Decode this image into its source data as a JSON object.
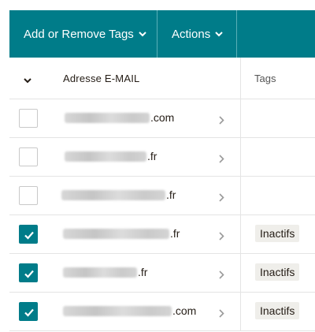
{
  "toolbar": {
    "add_remove_tags_label": "Add or Remove Tags",
    "actions_label": "Actions",
    "background_color": "#007c89"
  },
  "table": {
    "columns": {
      "email": "Adresse E-MAIL",
      "tags": "Tags"
    },
    "rows": [
      {
        "email_suffix": ".com",
        "checked": false,
        "tag": ""
      },
      {
        "email_suffix": ".fr",
        "checked": false,
        "tag": ""
      },
      {
        "email_suffix": ".fr",
        "checked": false,
        "tag": ""
      },
      {
        "email_suffix": ".fr",
        "checked": true,
        "tag": "Inactifs"
      },
      {
        "email_suffix": ".fr",
        "checked": true,
        "tag": "Inactifs"
      },
      {
        "email_suffix": ".com",
        "checked": true,
        "tag": "Inactifs"
      }
    ]
  },
  "icons": {
    "chevron": "chevron-down-icon",
    "row_arrow": "chevron-right-icon",
    "check": "checkmark-icon"
  }
}
